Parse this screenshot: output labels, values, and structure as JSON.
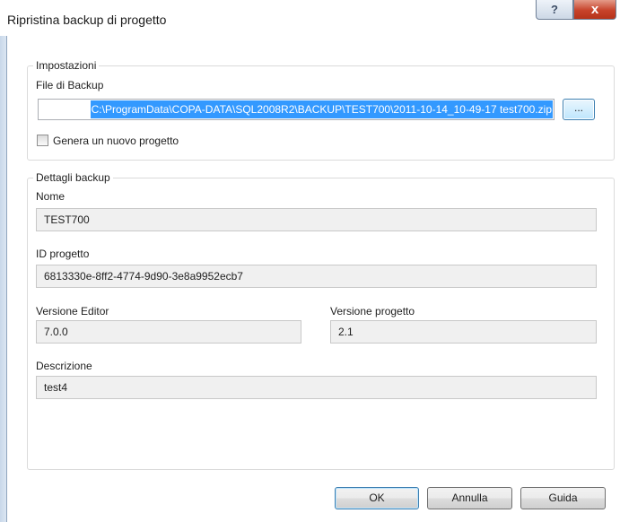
{
  "window": {
    "title": "Ripristina backup di progetto",
    "help_label": "?",
    "close_label": "x"
  },
  "settings": {
    "group_title": "Impostazioni",
    "file_label": "File di Backup",
    "file_path": "C:\\ProgramData\\COPA-DATA\\SQL2008R2\\BACKUP\\TEST700\\2011-10-14_10-49-17 test700.zip",
    "browse_label": "...",
    "new_project_label": "Genera un nuovo progetto",
    "new_project_checked": false
  },
  "details": {
    "group_title": "Dettagli backup",
    "name_label": "Nome",
    "name_value": "TEST700",
    "id_label": "ID progetto",
    "id_value": "6813330e-8ff2-4774-9d90-3e8a9952ecb7",
    "editor_version_label": "Versione Editor",
    "editor_version_value": "7.0.0",
    "project_version_label": "Versione progetto",
    "project_version_value": "2.1",
    "description_label": "Descrizione",
    "description_value": "test4"
  },
  "buttons": {
    "ok": "OK",
    "cancel": "Annulla",
    "help": "Guida"
  },
  "colors": {
    "selection": "#3399ff",
    "close_button": "#c7432b",
    "readonly_field": "#f0f0f0"
  }
}
